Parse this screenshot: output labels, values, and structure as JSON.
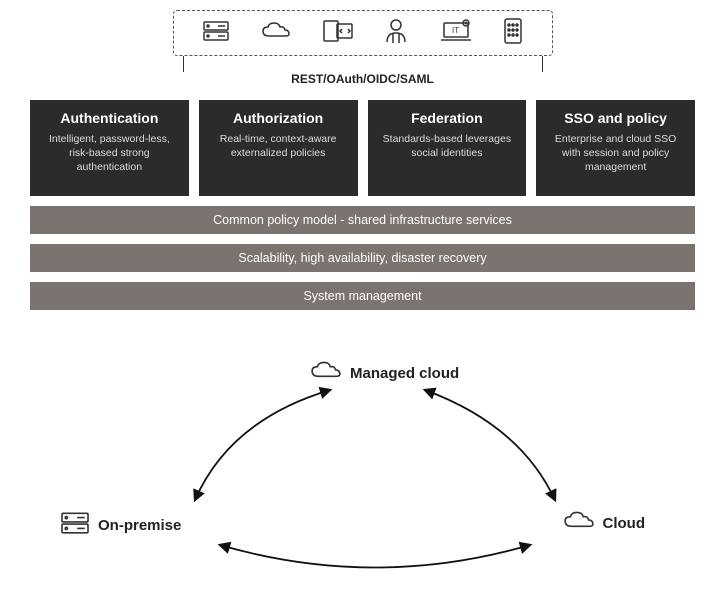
{
  "protocols": "REST/OAuth/OIDC/SAML",
  "cards": [
    {
      "title": "Authentication",
      "desc": "Intelligent, password-less, risk-based strong authentication"
    },
    {
      "title": "Authorization",
      "desc": "Real-time, context-aware externalized policies"
    },
    {
      "title": "Federation",
      "desc": "Standards-based leverages social identities"
    },
    {
      "title": "SSO and policy",
      "desc": "Enterprise and cloud SSO with session and policy management"
    }
  ],
  "bars": [
    "Common policy model - shared infrastructure services",
    "Scalability, high availability, disaster recovery",
    "System management"
  ],
  "nodes": {
    "managed": "Managed cloud",
    "onprem": "On-premise",
    "cloud": "Cloud"
  }
}
